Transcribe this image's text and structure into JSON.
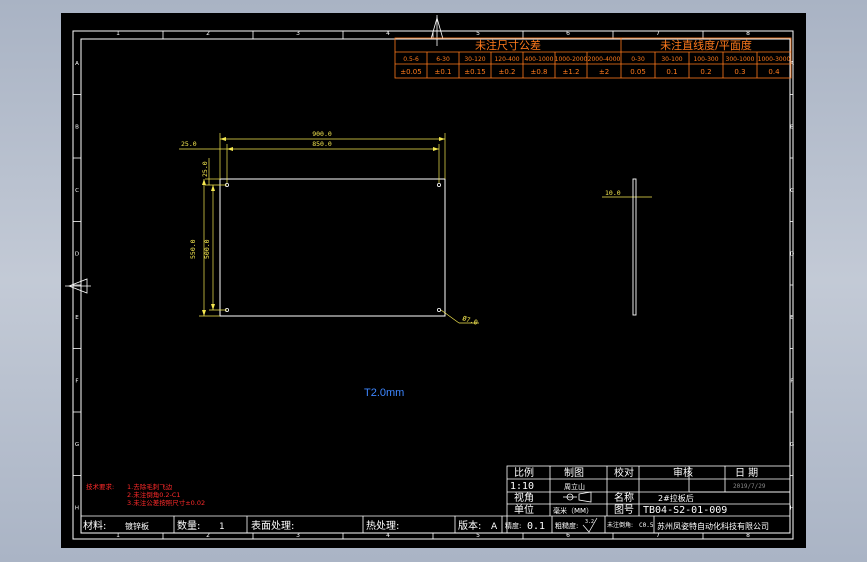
{
  "colors": {
    "background": "#000000",
    "frame": "#ffffff",
    "dimension": "#f5e850",
    "tolerance_table": "#ff7a1c",
    "notes": "#ff2a2a",
    "workspace": "#b6bfcd"
  },
  "frame": {
    "zone_columns": [
      "1",
      "2",
      "3",
      "4",
      "5",
      "6",
      "7",
      "8"
    ],
    "zone_rows": [
      "A",
      "B",
      "C",
      "D",
      "E",
      "F",
      "G",
      "H"
    ]
  },
  "tolerance_table": {
    "linear_title": "未注尺寸公差",
    "flatness_title": "未注直线度/平面度",
    "linear_ranges": [
      "0.5-6",
      "6-30",
      "30-120",
      "120-400",
      "400-1000",
      "1000-2000",
      "2000-4000"
    ],
    "linear_values": [
      "±0.05",
      "±0.1",
      "±0.15",
      "±0.2",
      "±0.8",
      "±1.2",
      "±2"
    ],
    "flatness_ranges": [
      "0-30",
      "30-100",
      "100-300",
      "300-1000",
      "1000-3000"
    ],
    "flatness_values": [
      "0.05",
      "0.1",
      "0.2",
      "0.3",
      "0.4"
    ]
  },
  "front_view": {
    "dims": {
      "overall_width": "900.0",
      "hole_spacing_x": "850.0",
      "edge_offset_x": "25.0",
      "edge_offset_y": "25.0",
      "overall_height": "550.0",
      "hole_spacing_y": "500.0",
      "hole": "Ø7.0"
    }
  },
  "side_view": {
    "thickness": "10.0"
  },
  "thickness_note": "T2.0mm",
  "tech_notes": {
    "title": "技术要求:",
    "items": [
      "1.去除毛刺飞边",
      "2.未注倒角0.2-C1",
      "3.未注公差按照尺寸±0.02"
    ]
  },
  "title_block": {
    "scale_label": "比例",
    "scale_value": "1:10",
    "drawn_label": "制图",
    "drawn_value": "周立山",
    "check_label": "校对",
    "review_label": "审核",
    "date_label": "日 期",
    "date_value": "2019/7/29",
    "projection_label": "视角",
    "name_label": "名称",
    "name_value": "2#拉板后",
    "unit_label": "单位",
    "unit_value": "毫米（MM）",
    "drawing_no_label": "图号",
    "drawing_no_value": "TB04-S2-01-009",
    "material_label": "材料:",
    "material_value": "镀锌板",
    "quantity_label": "数量:",
    "quantity_value": "1",
    "surface_label": "表面处理:",
    "heat_label": "热处理:",
    "version_label": "版本:",
    "version_value": "A",
    "precision_label": "精度:",
    "precision_value": "0.1",
    "roughness_label": "粗糙度:",
    "roughness_value": "3.2",
    "chamfer_label": "未注倒角:",
    "chamfer_value": "C0.5",
    "company": "苏州凤姿特自动化科技有限公司"
  }
}
